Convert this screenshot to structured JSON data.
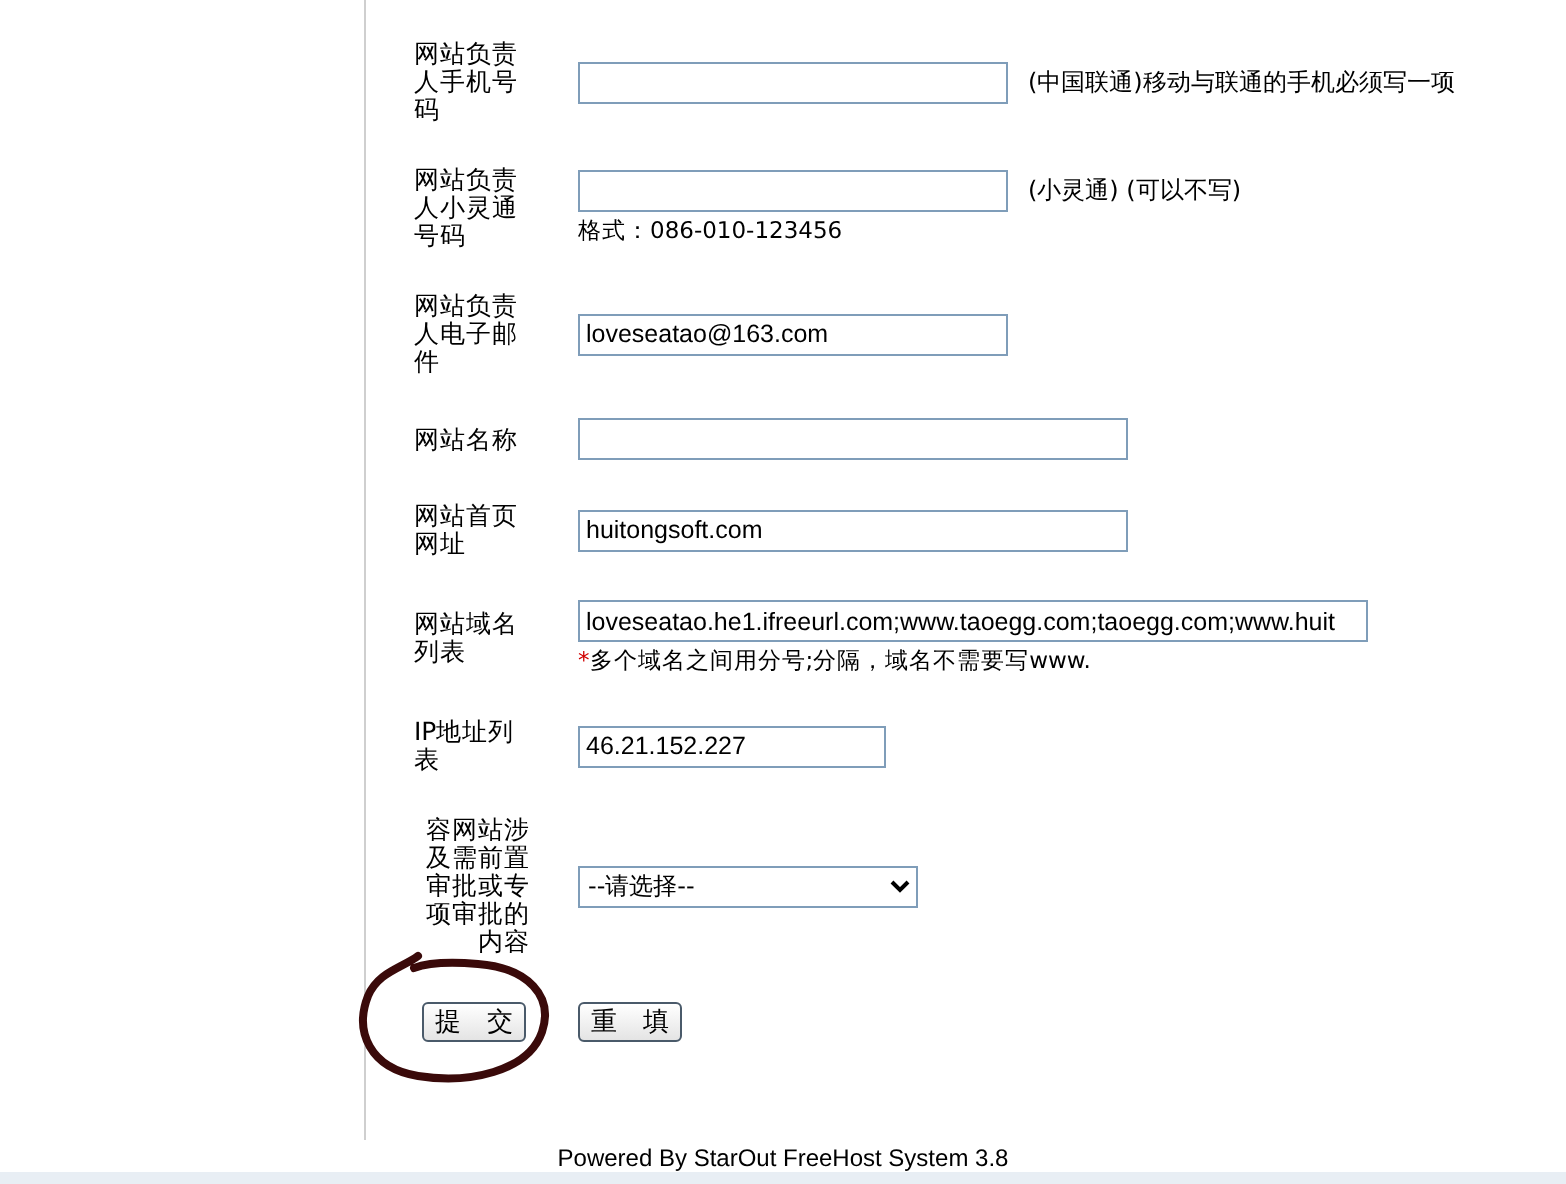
{
  "form": {
    "fields": [
      {
        "kind": "text",
        "label": "网站负责人手机号码",
        "note": "(中国联通)移动与联通的手机必须写一项"
      },
      {
        "kind": "text",
        "label": "网站负责人小灵通号码",
        "note": "(小灵通) (可以不写)",
        "hint": "格式：086-010-123456"
      },
      {
        "kind": "text",
        "label": "网站负责人电子邮件",
        "value": "loveseatao@163.com"
      },
      {
        "kind": "text",
        "label": "网站名称"
      },
      {
        "kind": "text",
        "label": "网站首页网址",
        "value": "huitongsoft.com"
      },
      {
        "kind": "text",
        "label": "网站域名列表",
        "value": "loveseatao.he1.ifreeurl.com;www.taoegg.com;taoegg.com;www.huit",
        "hint": "多个域名之间用分号;分隔，域名不需要写www.",
        "hint_mark": "*"
      },
      {
        "kind": "text",
        "label": "IP地址列表",
        "value": "46.21.152.227"
      },
      {
        "kind": "select",
        "label": "容网站涉及需前置审批或专项审批的内容",
        "value": "--请选择--"
      }
    ],
    "buttons": [
      {
        "label": "提　交",
        "circled": true
      },
      {
        "label": "重　填",
        "circled": false
      }
    ]
  },
  "footer": "Powered By StarOut FreeHost System 3.8"
}
